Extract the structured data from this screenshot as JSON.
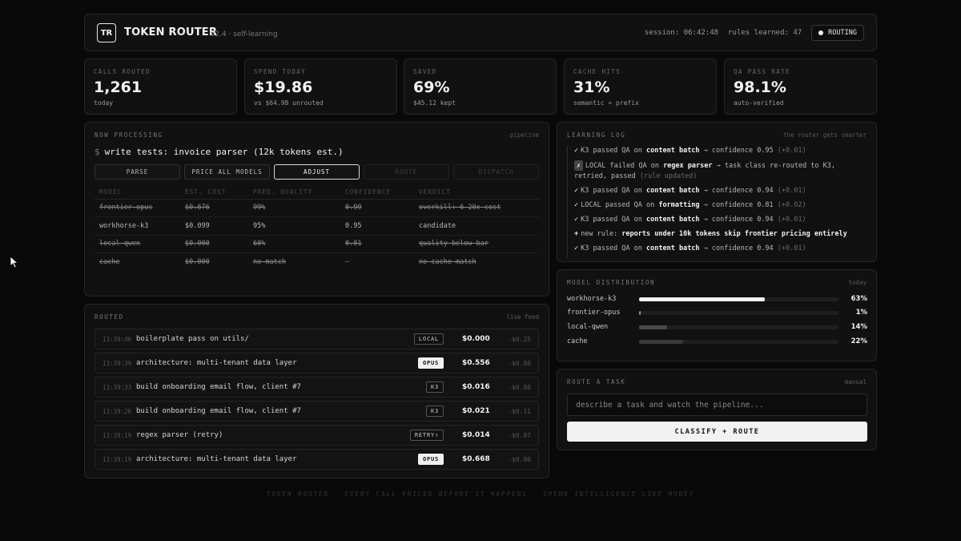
{
  "header": {
    "logo": "TR",
    "title": "TOKEN ROUTER",
    "version": "v2.4 · self-learning",
    "session": "session: 06:42:48",
    "rules_learned": "rules learned: 47",
    "routing_label": "ROUTING"
  },
  "stats": [
    {
      "label": "CALLS ROUTED",
      "value": "1,261",
      "sub": "today"
    },
    {
      "label": "SPEND TODAY",
      "value": "$19.86",
      "sub": "vs $64.98 unrouted"
    },
    {
      "label": "SAVED",
      "value": "69%",
      "sub": "$45.12 kept"
    },
    {
      "label": "CACHE HITS",
      "value": "31%",
      "sub": "semantic + prefix"
    },
    {
      "label": "QA PASS RATE",
      "value": "98.1%",
      "sub": "auto-verified"
    }
  ],
  "processing": {
    "title": "NOW PROCESSING",
    "tag": "pipeline",
    "prompt": "$",
    "command": "write tests: invoice parser (12k tokens est.)",
    "steps": [
      "PARSE",
      "PRICE ALL MODELS",
      "ADJUST",
      "ROUTE",
      "DISPATCH"
    ],
    "columns": [
      "MODEL",
      "EST. COST",
      "PRED. QUALITY",
      "CONFIDENCE",
      "VERDICT"
    ],
    "rows": [
      [
        "frontier-opus",
        "$0.676",
        "99%",
        "0.99",
        "overkill: 6-20x cost"
      ],
      [
        "workhorse-k3",
        "$0.099",
        "95%",
        "0.95",
        "candidate"
      ],
      [
        "local-qwen",
        "$0.000",
        "68%",
        "0.81",
        "quality below bar"
      ],
      [
        "cache",
        "$0.000",
        "no match",
        "—",
        "no cache match"
      ]
    ]
  },
  "routed": {
    "title": "ROUTED",
    "tag": "live feed",
    "rows": [
      {
        "time": "13:39:46",
        "task": "boilerplate pass on utils/",
        "badge": "LOCAL",
        "cost": "$0.000",
        "saved": "-$0.25"
      },
      {
        "time": "13:39:39",
        "task": "architecture: multi-tenant data layer",
        "badge": "OPUS",
        "cost": "$0.556",
        "saved": "-$0.00"
      },
      {
        "time": "13:39:33",
        "task": "build onboarding email flow, client #7",
        "badge": "K3",
        "cost": "$0.016",
        "saved": "-$0.08"
      },
      {
        "time": "13:39:26",
        "task": "build onboarding email flow, client #7",
        "badge": "K3",
        "cost": "$0.021",
        "saved": "-$0.11"
      },
      {
        "time": "13:39:19",
        "task": "regex parser (retry)",
        "badge": "RETRY↑",
        "cost": "$0.014",
        "saved": "-$0.07"
      },
      {
        "time": "13:39:19",
        "task": "architecture: multi-tenant data layer",
        "badge": "OPUS",
        "cost": "$0.668",
        "saved": "-$0.00"
      }
    ]
  },
  "learning": {
    "title": "LEARNING LOG",
    "tag": "the router gets smarter",
    "entries": [
      {
        "mark": "✓",
        "pre": "K3 passed QA on ",
        "bold": "content batch",
        "post": " → confidence 0.95 ",
        "delta": "(+0.01)"
      },
      {
        "mark": "✗",
        "pre": "LOCAL failed QA on ",
        "bold": "regex parser",
        "post": " → task class re-routed to K3, retried, passed ",
        "delta": "(rule updated)"
      },
      {
        "mark": "✓",
        "pre": "K3 passed QA on ",
        "bold": "content batch",
        "post": " → confidence 0.94 ",
        "delta": "(+0.01)"
      },
      {
        "mark": "✓",
        "pre": "LOCAL passed QA on ",
        "bold": "formatting",
        "post": " → confidence 0.81 ",
        "delta": "(+0.02)"
      },
      {
        "mark": "✓",
        "pre": "K3 passed QA on ",
        "bold": "content batch",
        "post": " → confidence 0.94 ",
        "delta": "(+0.01)"
      },
      {
        "mark": "+",
        "pre": "new rule: ",
        "bold": "reports under 10k tokens skip frontier pricing entirely",
        "post": "",
        "delta": ""
      },
      {
        "mark": "✓",
        "pre": "K3 passed QA on ",
        "bold": "content batch",
        "post": " → confidence 0.94 ",
        "delta": "(+0.01)"
      }
    ]
  },
  "distribution": {
    "title": "MODEL DISTRIBUTION",
    "tag": "today",
    "rows": [
      {
        "name": "workhorse-k3",
        "pct": "63%",
        "value": 63,
        "color": "#f2f2f2"
      },
      {
        "name": "frontier-opus",
        "pct": "1%",
        "value": 1,
        "color": "#9a9a9a"
      },
      {
        "name": "local-qwen",
        "pct": "14%",
        "value": 14,
        "color": "#4a4a4a"
      },
      {
        "name": "cache",
        "pct": "22%",
        "value": 22,
        "color": "#3a3a3a"
      }
    ]
  },
  "route_task": {
    "title": "ROUTE A TASK",
    "tag": "manual",
    "placeholder": "describe a task and watch the pipeline...",
    "button": "CLASSIFY + ROUTE"
  },
  "footer": "TOKEN ROUTER · EVERY CALL PRICED BEFORE IT HAPPENS · SPEND INTELLIGENCE LIKE MONEY"
}
